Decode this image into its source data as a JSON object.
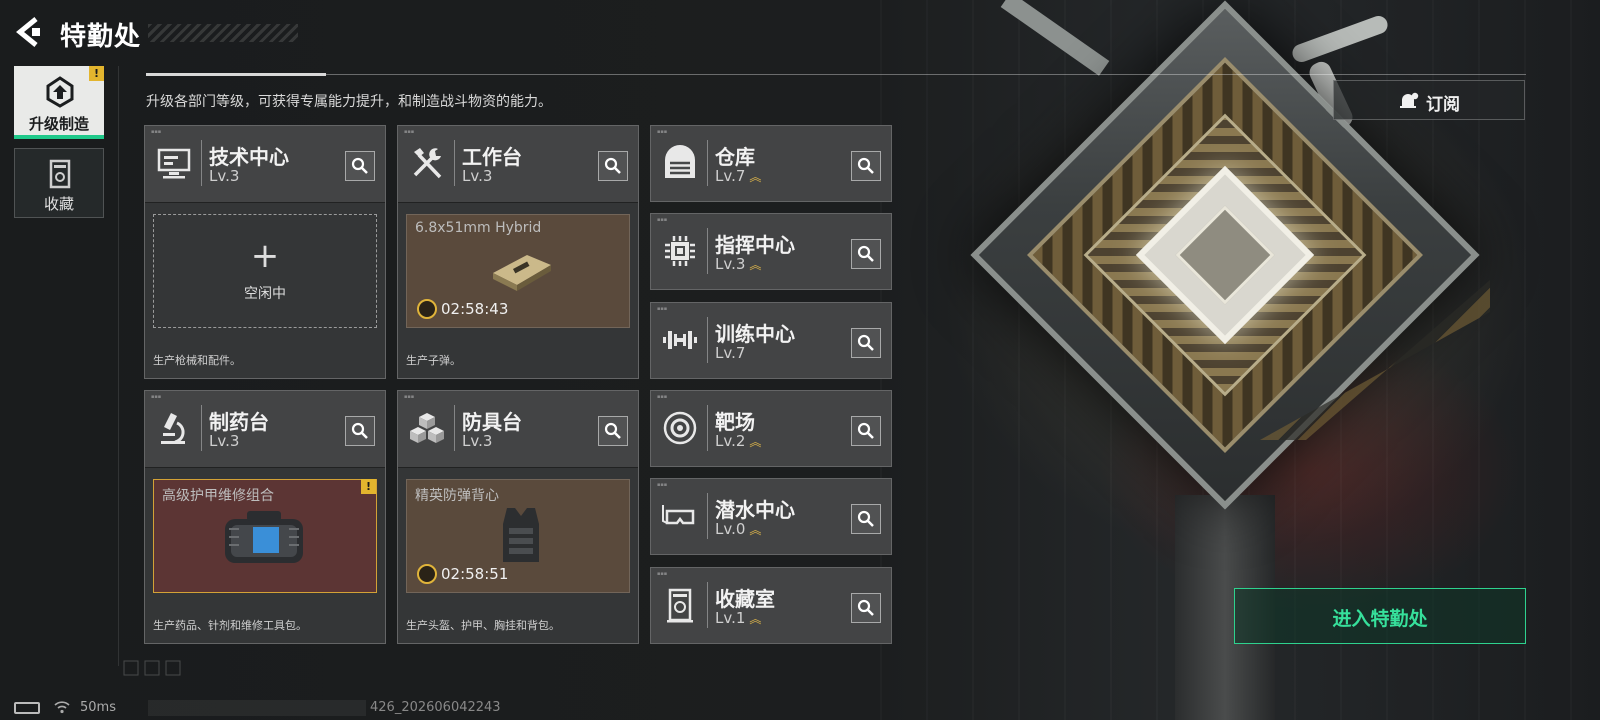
{
  "header": {
    "title": "特勤处",
    "subtitle": "升级各部门等级，可获得专属能力提升，和制造战斗物资的能力。"
  },
  "sidebar": {
    "items": [
      {
        "label": "升级制造",
        "icon": "upgrade-gear-icon",
        "active": true,
        "alert": "!"
      },
      {
        "label": "收藏",
        "icon": "collection-icon",
        "active": false
      }
    ]
  },
  "main_departments": [
    {
      "name": "技术中心",
      "level": "Lv.3",
      "icon": "monitor-icon",
      "slot": {
        "state": "idle",
        "plus": "+",
        "idle_label": "空闲中"
      },
      "desc": "生产枪械和配件。"
    },
    {
      "name": "工作台",
      "level": "Lv.3",
      "icon": "tools-icon",
      "slot": {
        "state": "producing",
        "item": "6.8x51mm Hybrid",
        "timer": "02:58:43"
      },
      "desc": "生产子弹。"
    },
    {
      "name": "制药台",
      "level": "Lv.3",
      "icon": "microscope-icon",
      "slot": {
        "state": "ready",
        "item": "高级护甲维修组合",
        "alert": "!"
      },
      "desc": "生产药品、针剂和维修工具包。"
    },
    {
      "name": "防具台",
      "level": "Lv.3",
      "icon": "blocks-icon",
      "slot": {
        "state": "producing",
        "item": "精英防弹背心",
        "timer": "02:58:51"
      },
      "desc": "生产头盔、护甲、胸挂和背包。"
    }
  ],
  "side_departments": [
    {
      "name": "仓库",
      "level": "Lv.7",
      "upgradable": true,
      "icon": "warehouse-icon"
    },
    {
      "name": "指挥中心",
      "level": "Lv.3",
      "upgradable": true,
      "icon": "command-chip-icon"
    },
    {
      "name": "训练中心",
      "level": "Lv.7",
      "upgradable": false,
      "icon": "dumbbell-icon"
    },
    {
      "name": "靶场",
      "level": "Lv.2",
      "upgradable": true,
      "icon": "target-icon"
    },
    {
      "name": "潜水中心",
      "level": "Lv.0",
      "upgradable": true,
      "icon": "diving-mask-icon"
    },
    {
      "name": "收藏室",
      "level": "Lv.1",
      "upgradable": true,
      "icon": "vault-icon"
    }
  ],
  "upgrade_mark": "︽",
  "actions": {
    "subscribe": "订阅",
    "enter": "进入特勤处"
  },
  "status_bar": {
    "ping": "50ms",
    "build": "426_202606042243"
  },
  "colors": {
    "accent_green": "#36e09b",
    "alert_yellow": "#e3b52e",
    "upgrade_gold": "#d9b24a"
  }
}
